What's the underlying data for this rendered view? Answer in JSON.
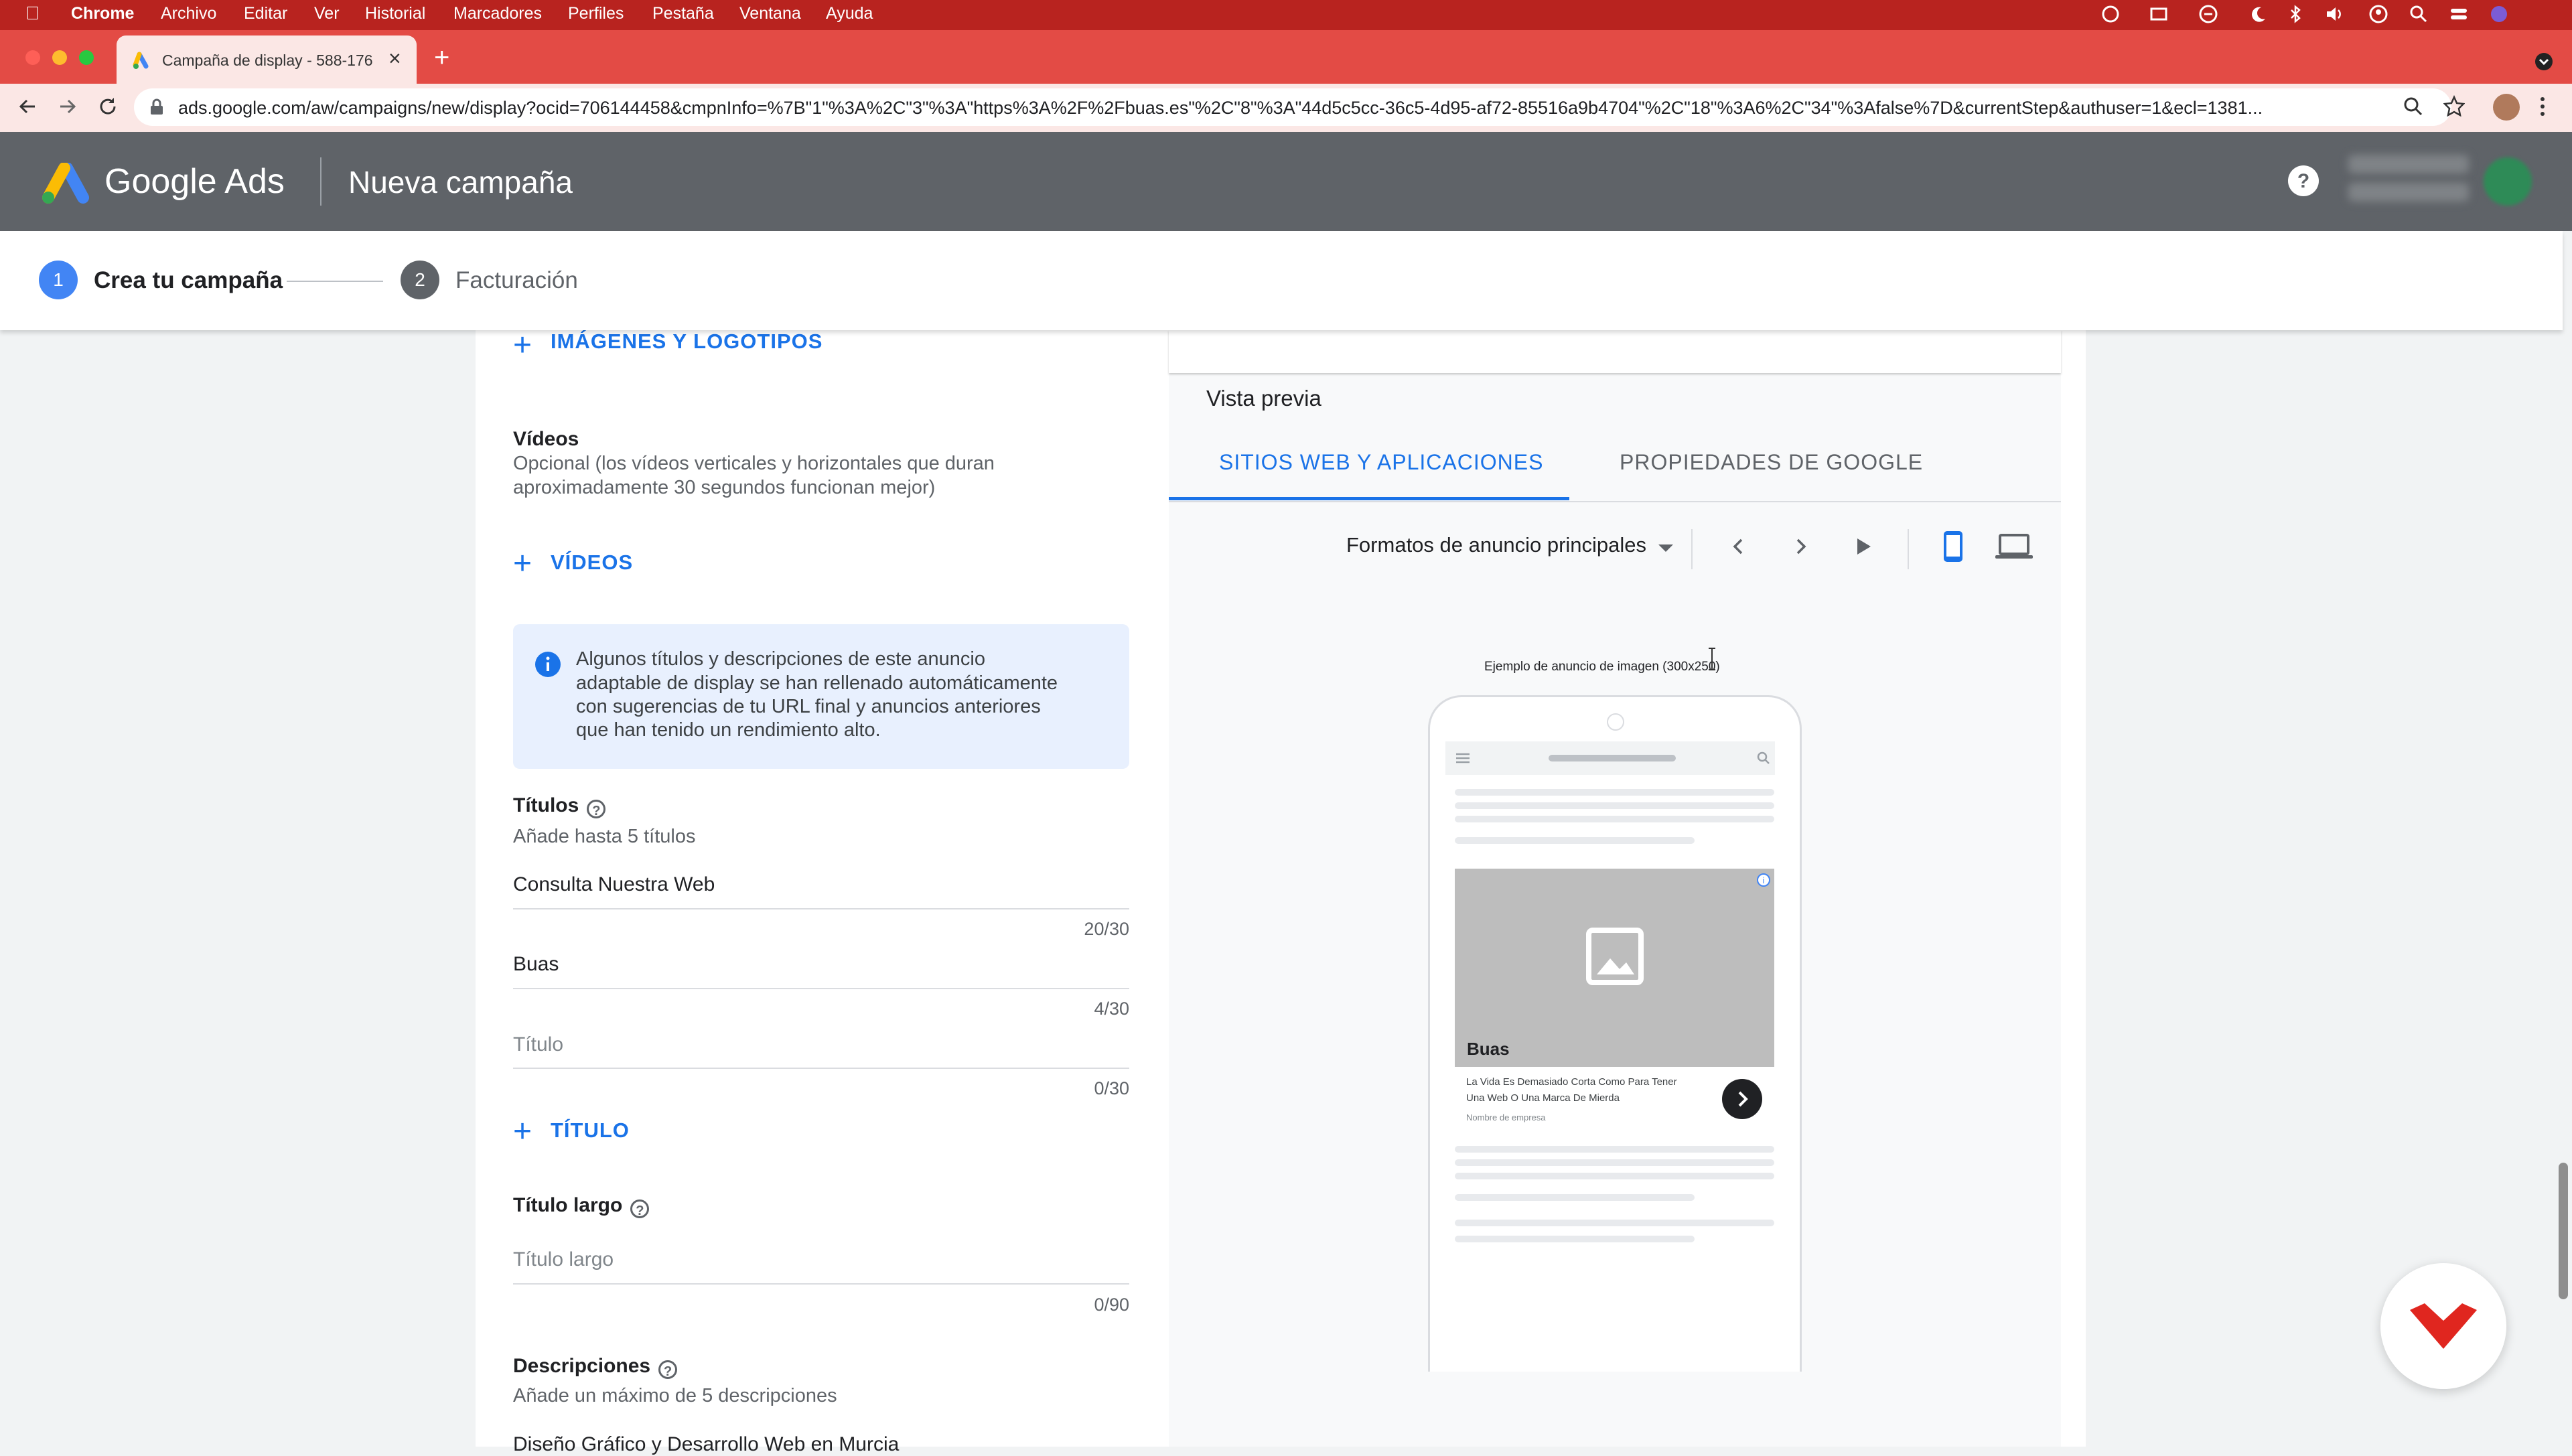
{
  "macmenu": {
    "items": [
      "Chrome",
      "Archivo",
      "Editar",
      "Ver",
      "Historial",
      "Marcadores",
      "Perfiles",
      "Pestaña",
      "Ventana",
      "Ayuda"
    ]
  },
  "browser": {
    "tab_title": "Campaña de display - 588-176",
    "url": "ads.google.com/aw/campaigns/new/display?ocid=706144458&cmpnInfo=%7B\"1\"%3A%2C\"3\"%3A\"https%3A%2F%2Fbuas.es\"%2C\"8\"%3A\"44d5c5cc-36c5-4d95-af72-85516a9b4704\"%2C\"18\"%3A6%2C\"34\"%3Afalse%7D&currentStep&authuser=1&ecl=1381..."
  },
  "header": {
    "product": "Google Ads",
    "page_title": "Nueva campaña"
  },
  "stepper": {
    "step1_num": "1",
    "step1_label": "Crea tu campaña",
    "step2_num": "2",
    "step2_label": "Facturación"
  },
  "form": {
    "images_button": "IMÁGENES Y LOGOTIPOS",
    "videos_title": "Vídeos",
    "videos_desc_line1": "Opcional (los vídeos verticales y horizontales que duran",
    "videos_desc_line2": "aproximadamente 30 segundos funcionan mejor)",
    "videos_button": "VÍDEOS",
    "info_line1": "Algunos títulos y descripciones de este anuncio",
    "info_line2": "adaptable de display se han rellenado automáticamente",
    "info_line3": "con sugerencias de tu URL final y anuncios anteriores",
    "info_line4": "que han tenido un rendimiento alto.",
    "titles_label": "Títulos",
    "titles_hint": "Añade hasta 5 títulos",
    "title1_value": "Consulta Nuestra Web",
    "title1_counter": "20/30",
    "title2_value": "Buas",
    "title2_counter": "4/30",
    "title3_placeholder": "Título",
    "title3_counter": "0/30",
    "add_title_button": "TÍTULO",
    "long_title_label": "Título largo",
    "long_title_placeholder": "Título largo",
    "long_title_counter": "0/90",
    "descriptions_label": "Descripciones",
    "descriptions_hint": "Añade un máximo de 5 descripciones",
    "description1_value": "Diseño Gráfico y Desarrollo Web en Murcia"
  },
  "preview": {
    "title": "Vista previa",
    "tab1": "SITIOS WEB Y APLICACIONES",
    "tab2": "PROPIEDADES DE GOOGLE",
    "format_select": "Formatos de anuncio principales",
    "example_caption": "Ejemplo de anuncio de imagen (300x250)",
    "ad_headline": "Buas",
    "ad_desc_line1": "La Vida Es Demasiado Corta Como Para Tener",
    "ad_desc_line2": "Una Web O Una Marca De Mierda",
    "ad_business": "Nombre de empresa"
  },
  "colors": {
    "mac_bar": "#b8231f",
    "tab_strip": "#e34b45",
    "accent_blue": "#1a73e8",
    "ads_header": "#5f6368"
  }
}
